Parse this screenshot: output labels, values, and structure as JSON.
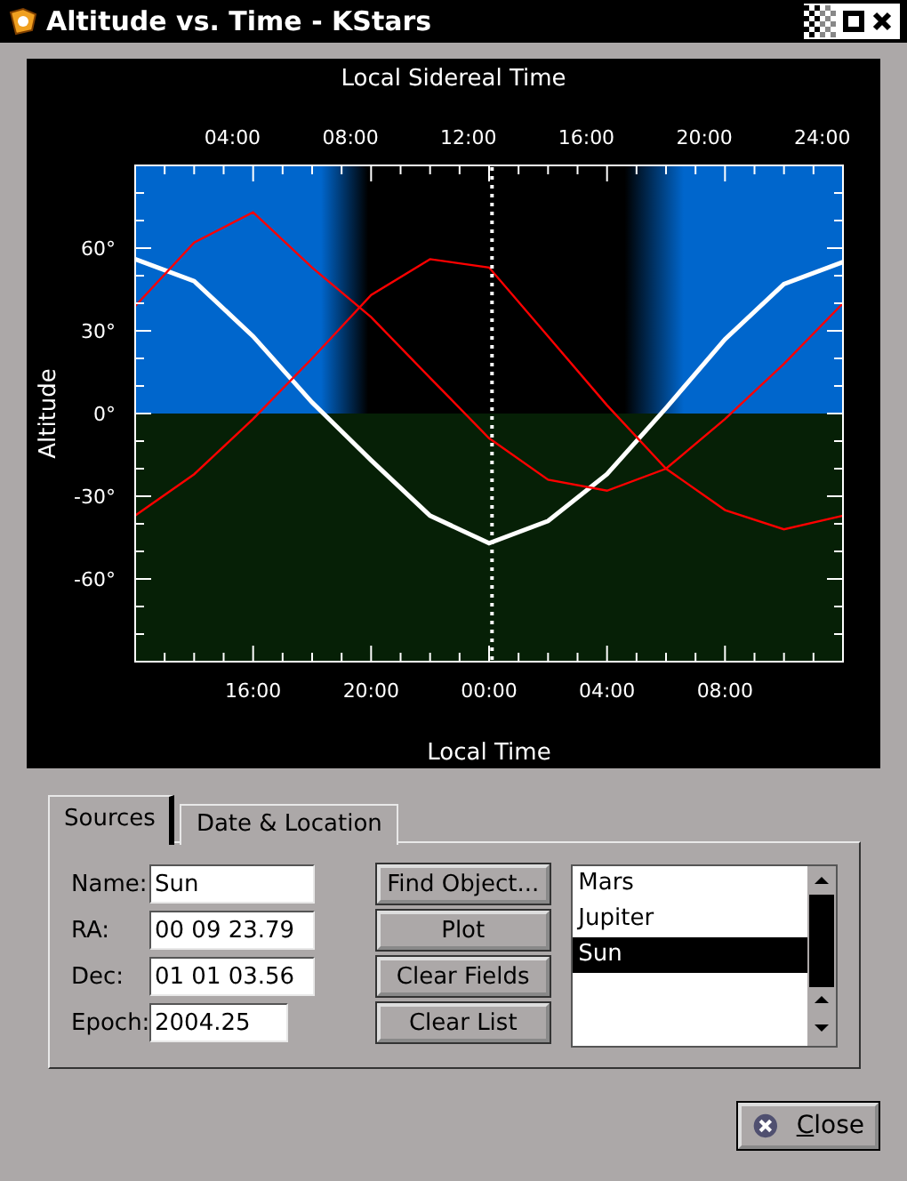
{
  "window": {
    "title": "Altitude vs. Time - KStars"
  },
  "chart": {
    "top_axis": {
      "title": "Local Sidereal Time",
      "labels": [
        "04:00",
        "08:00",
        "12:00",
        "16:00",
        "20:00",
        "24:00"
      ]
    },
    "chart_data": {
      "type": "line",
      "xlabel": "Local Time",
      "ylabel": "Altitude",
      "categories": [
        null,
        null,
        "16:00",
        null,
        "20:00",
        null,
        "00:00",
        null,
        "04:00",
        null,
        "08:00",
        null,
        null
      ],
      "series": [
        {
          "color": "#ffffff",
          "values": [
            56,
            48,
            28,
            4,
            -17,
            -37,
            -47,
            -39,
            -22,
            2,
            27,
            47,
            55
          ]
        },
        {
          "color": "#ff0000",
          "values": [
            39,
            62,
            73,
            53,
            35,
            13,
            -9,
            -24,
            -28,
            -20,
            -2,
            18,
            40
          ]
        },
        {
          "color": "#ff0000",
          "values": [
            -37,
            -22,
            -2,
            20,
            43,
            56,
            53,
            28,
            3,
            -20,
            -35,
            -42,
            -37
          ]
        }
      ],
      "ylim": [
        -90,
        90
      ],
      "yticks": [
        {
          "value": 60,
          "label": "60°"
        },
        {
          "value": 30,
          "label": "30°"
        },
        {
          "value": 0,
          "label": "0°"
        },
        {
          "value": -30,
          "label": "-30°"
        },
        {
          "value": -60,
          "label": "-60°"
        }
      ]
    }
  },
  "tabs": [
    {
      "label": "Sources",
      "selected": true
    },
    {
      "label": "Date & Location",
      "selected": false
    }
  ],
  "fields": [
    {
      "label": "Name:",
      "value": "Sun",
      "wide": true
    },
    {
      "label": "RA:",
      "value": "00 09 23.79",
      "wide": true
    },
    {
      "label": "Dec:",
      "value": "01 01 03.56",
      "wide": true
    },
    {
      "label": "Epoch:",
      "value": "2004.25",
      "wide": false
    }
  ],
  "buttons": [
    "Find Object...",
    "Plot",
    "Clear Fields",
    "Clear List"
  ],
  "objects": [
    {
      "label": "Mars",
      "selected": false
    },
    {
      "label": "Jupiter",
      "selected": false
    },
    {
      "label": "Sun",
      "selected": true
    }
  ],
  "close_button": {
    "label": "Close"
  }
}
